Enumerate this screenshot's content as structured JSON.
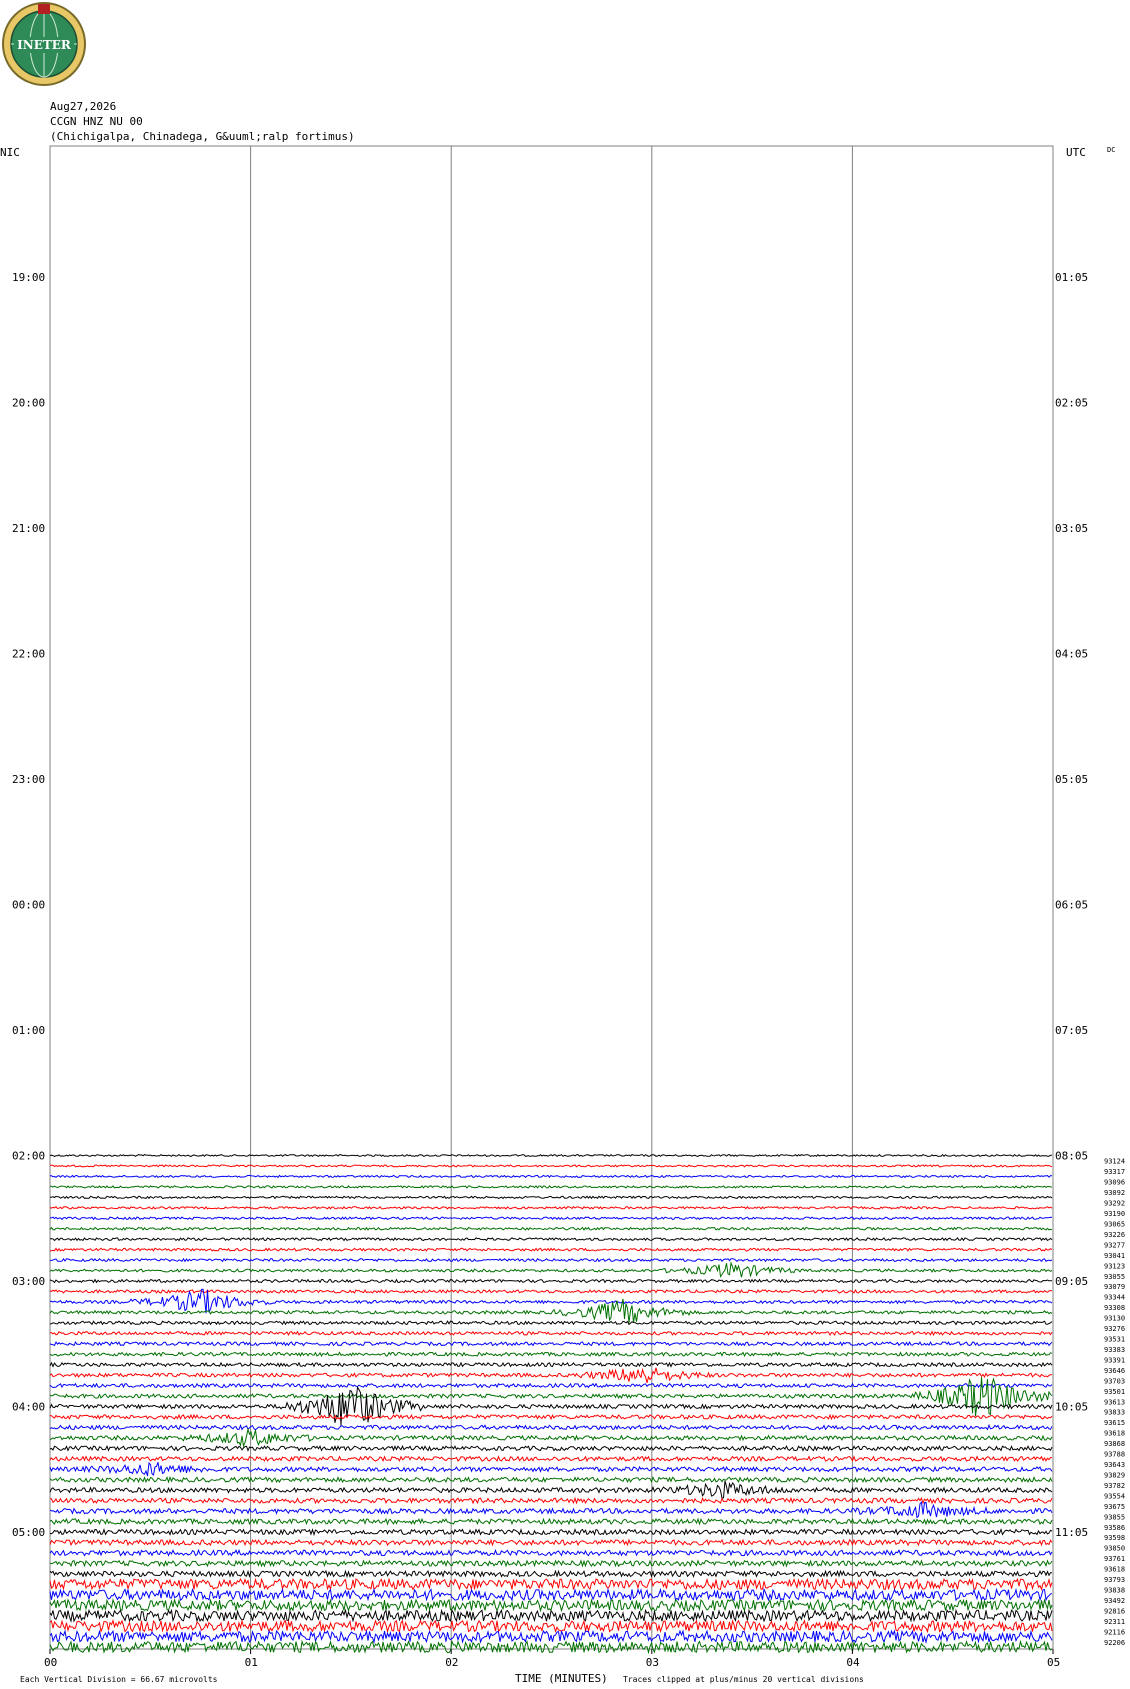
{
  "header": {
    "logo_text": "INETER",
    "date": "Aug27,2026",
    "station": "CCGN HNZ NU 00",
    "location": "(Chichigalpa, Chinadega, G&uuml;ralp fortimus)"
  },
  "colors": {
    "trace_cycle": [
      "#000000",
      "#ff0000",
      "#0000ff",
      "#007000"
    ],
    "gridline": "#808080",
    "logo_ring": "#e8c866",
    "logo_globe": "#2e8b57"
  },
  "chart_data": {
    "type": "line",
    "title": "",
    "xlabel": "TIME (MINUTES)",
    "ylabel_left": "NIC",
    "ylabel_right": "UTC",
    "corner_label": "DC",
    "xlim": [
      0,
      5
    ],
    "x_ticks": [
      "00",
      "01",
      "02",
      "03",
      "04",
      "05"
    ],
    "left_hour_labels": [
      "19:00",
      "20:00",
      "21:00",
      "22:00",
      "23:00",
      "00:00",
      "01:00",
      "02:00",
      "03:00",
      "04:00",
      "05:00"
    ],
    "right_hour_labels": [
      "01:05",
      "02:05",
      "03:05",
      "04:05",
      "05:05",
      "06:05",
      "07:05",
      "08:05",
      "09:05",
      "10:05",
      "11:05"
    ],
    "traces_start_hour_index": 7,
    "trace_count": 48,
    "trace_values": [
      "93124",
      "93317",
      "93096",
      "93092",
      "93292",
      "93190",
      "93065",
      "93226",
      "93277",
      "93041",
      "93123",
      "93055",
      "93079",
      "93344",
      "93308",
      "93130",
      "93276",
      "93531",
      "93383",
      "93391",
      "93646",
      "93703",
      "93501",
      "93613",
      "93833",
      "93615",
      "93618",
      "93868",
      "93788",
      "93643",
      "93829",
      "93782",
      "93554",
      "93675",
      "93855",
      "93586",
      "93598",
      "93850",
      "93761",
      "93618",
      "93793",
      "93838",
      "93492",
      "92816",
      "92311",
      "92116",
      "92206"
    ],
    "events": [
      {
        "trace": 11,
        "minute": 3.4,
        "amp": 1.5
      },
      {
        "trace": 14,
        "minute": 0.75,
        "amp": 2.5
      },
      {
        "trace": 15,
        "minute": 2.85,
        "amp": 2.5
      },
      {
        "trace": 21,
        "minute": 2.95,
        "amp": 1.8
      },
      {
        "trace": 23,
        "minute": 4.65,
        "amp": 4.5
      },
      {
        "trace": 24,
        "minute": 1.5,
        "amp": 5
      },
      {
        "trace": 27,
        "minute": 1.0,
        "amp": 1.5
      },
      {
        "trace": 30,
        "minute": 0.5,
        "amp": 1.2
      },
      {
        "trace": 32,
        "minute": 3.35,
        "amp": 1.5
      },
      {
        "trace": 34,
        "minute": 4.35,
        "amp": 1.4
      }
    ],
    "footer_left": "Each Vertical Division =   66.67 microvolts",
    "footer_right": "Traces clipped at plus/minus 20 vertical divisions"
  }
}
